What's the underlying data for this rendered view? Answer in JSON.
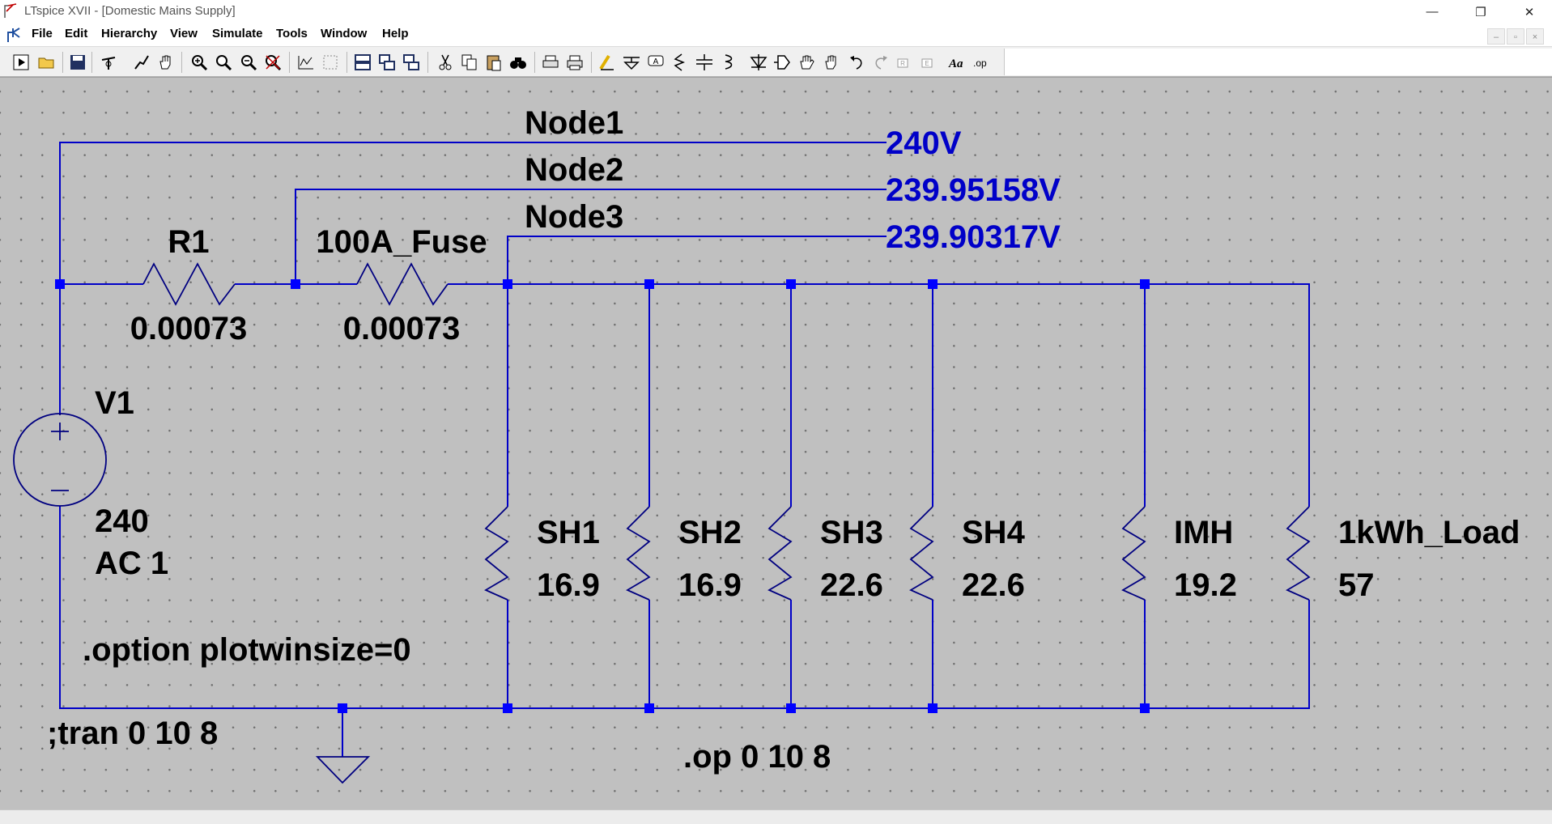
{
  "window": {
    "title": "LTspice XVII - [Domestic Mains Supply]",
    "minimize": "—",
    "restore": "❐",
    "close": "✕"
  },
  "menu": {
    "items": [
      "File",
      "Edit",
      "Hierarchy",
      "View",
      "Simulate",
      "Tools",
      "Window",
      "Help"
    ],
    "mdi_buttons": [
      "–",
      "▫",
      "×"
    ]
  },
  "toolbar": {
    "icons": [
      "run-icon",
      "open-icon",
      "save-icon",
      "control-panel-icon",
      "probe-icon",
      "pan-icon",
      "zoom-in-icon",
      "zoom-area-icon",
      "zoom-out-icon",
      "zoom-fit-icon",
      "autorange-icon",
      "grid-icon",
      "tile-horizontal-icon",
      "tile-vertical-icon",
      "cascade-icon",
      "cut-icon",
      "copy-icon",
      "paste-icon",
      "find-icon",
      "print-setup-icon",
      "print-icon",
      "wire-icon",
      "ground-icon",
      "label-net-icon",
      "resistor-icon",
      "capacitor-icon",
      "inductor-icon",
      "diode-icon",
      "component-icon",
      "move-icon",
      "drag-icon",
      "undo-icon",
      "redo-icon",
      "rotate-icon",
      "mirror-icon",
      "text-icon",
      "spice-directive-icon"
    ],
    "text_icon_label": "Aa",
    "op_icon_label": ".op"
  },
  "colors": {
    "wire": "#0000c8",
    "junction": "#0000ff",
    "node_voltage": "#0000c8",
    "canvas": "#c0c0c0",
    "component": "#000000"
  },
  "schematic": {
    "nodes": [
      {
        "name": "Node1",
        "voltage": "240V"
      },
      {
        "name": "Node2",
        "voltage": "239.95158V"
      },
      {
        "name": "Node3",
        "voltage": "239.90317V"
      }
    ],
    "r1": {
      "name": "R1",
      "value": "0.00073"
    },
    "fuse": {
      "name": "100A_Fuse",
      "value": "0.00073"
    },
    "v1": {
      "name": "V1",
      "value1": "240",
      "value2": "AC 1"
    },
    "loads": [
      {
        "name": "SH1",
        "value": "16.9"
      },
      {
        "name": "SH2",
        "value": "16.9"
      },
      {
        "name": "SH3",
        "value": "22.6"
      },
      {
        "name": "SH4",
        "value": "22.6"
      },
      {
        "name": "IMH",
        "value": "19.2"
      },
      {
        "name": "1kWh_Load",
        "value": "57"
      }
    ],
    "directives": {
      "option": ".option plotwinsize=0",
      "tran": ";tran 0 10 8",
      "op": ".op 0 10 8"
    }
  }
}
